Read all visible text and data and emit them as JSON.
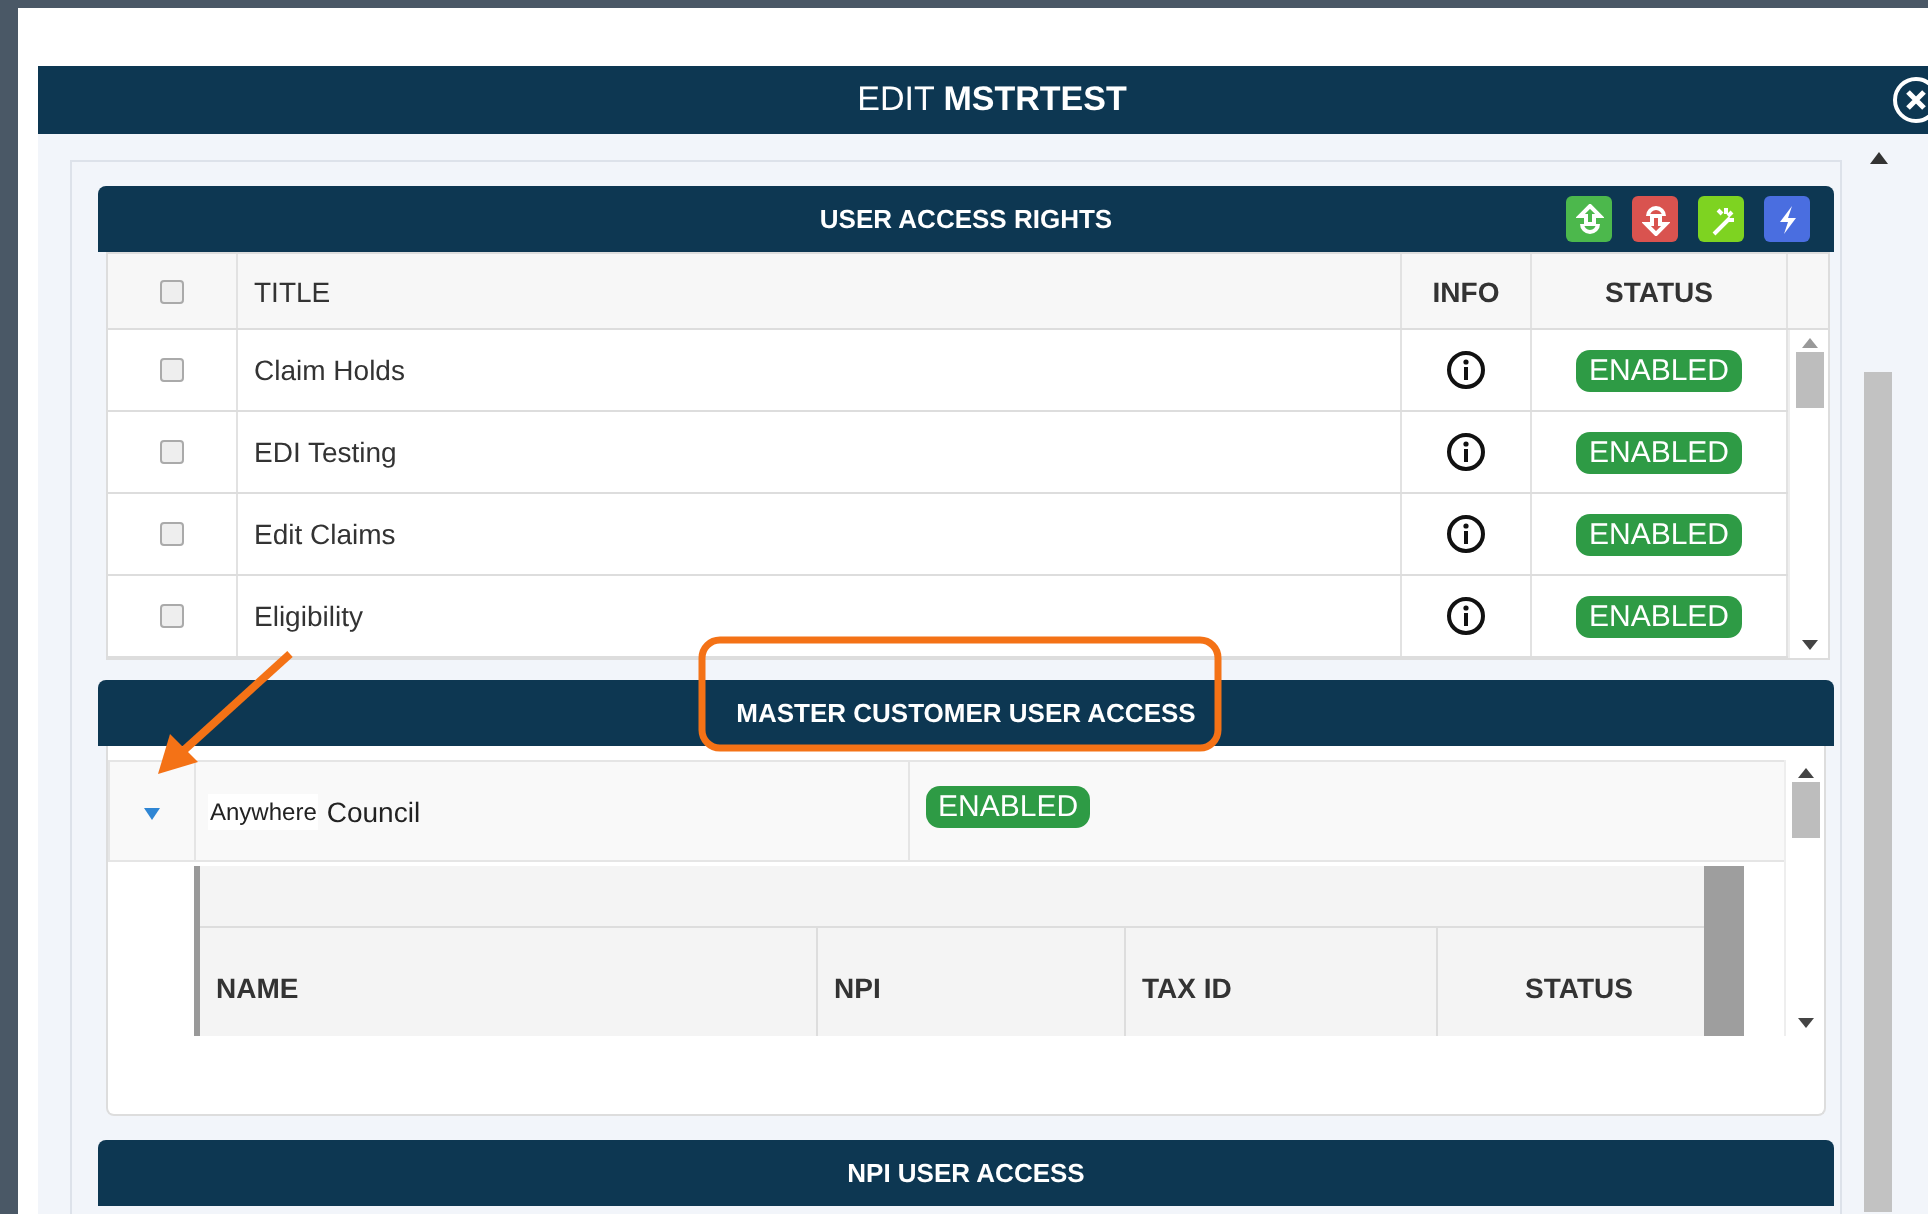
{
  "dialog": {
    "title": "EDIT **MSTRTEST**"
  },
  "user_access_rights": {
    "title": "USER ACCESS RIGHTS",
    "toolbar": [
      {
        "kind": "up",
        "color": "#4cb84c"
      },
      {
        "kind": "down",
        "color": "#d9534f"
      },
      {
        "kind": "wand",
        "color": "#7ed321"
      },
      {
        "kind": "bolt",
        "color": "#4a6ee0"
      }
    ],
    "columns": [
      "TITLE",
      "INFO",
      "STATUS"
    ],
    "select_all": {
      "checked": false
    },
    "rows": [
      {
        "checked": false,
        "title": "Claim Holds",
        "status": "ENABLED"
      },
      {
        "checked": false,
        "title": "EDI Testing",
        "status": "ENABLED"
      },
      {
        "checked": false,
        "title": "Edit Claims",
        "status": "ENABLED"
      },
      {
        "checked": false,
        "title": "Eligibility",
        "status": "ENABLED"
      }
    ]
  },
  "master_customer_user_access": {
    "title": "MASTER CUSTOMER USER ACCESS",
    "rows": [
      {
        "expanded": true,
        "name_prefix": "Anywhere",
        "name": "Council",
        "status": "ENABLED",
        "columns": [
          "NAME",
          "NPI",
          "TAX ID",
          "STATUS"
        ]
      }
    ]
  },
  "npi_user_access": {
    "title": "NPI USER ACCESS"
  }
}
